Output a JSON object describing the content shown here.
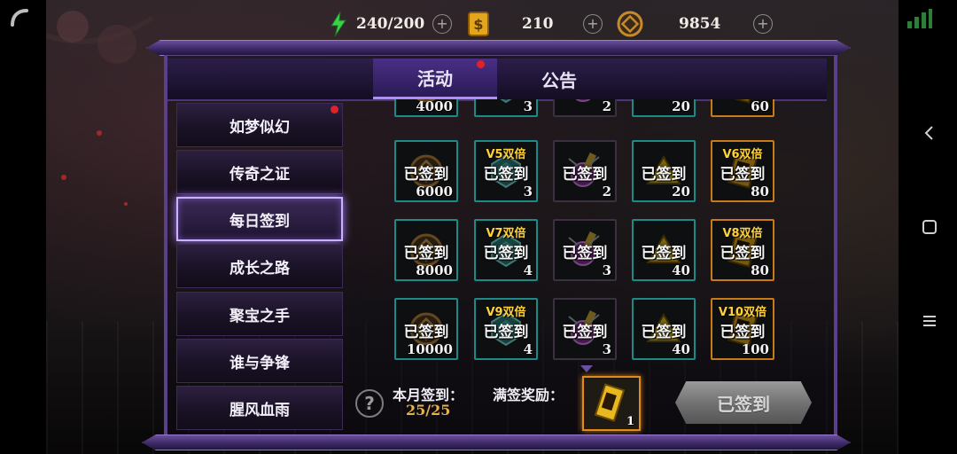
{
  "resources": {
    "energy": {
      "icon": "lightning-icon",
      "value": "240/200"
    },
    "ticket": {
      "icon": "gold-ticket-icon",
      "value": "210"
    },
    "coin": {
      "icon": "coin-icon",
      "value": "9854"
    }
  },
  "tabs": [
    {
      "label": "活动",
      "active": true,
      "badge": true
    },
    {
      "label": "公告",
      "active": false,
      "badge": false
    }
  ],
  "sidebar": {
    "items": [
      {
        "label": "如梦似幻",
        "badge": true
      },
      {
        "label": "传奇之证"
      },
      {
        "label": "每日签到",
        "active": true
      },
      {
        "label": "成长之路"
      },
      {
        "label": "聚宝之手"
      },
      {
        "label": "谁与争锋"
      },
      {
        "label": "腥风血雨"
      }
    ]
  },
  "grid": {
    "signed_label": "已签到",
    "partial_row": [
      {
        "item": "coin",
        "qty": "4000"
      },
      {
        "item": "gem",
        "qty": "3"
      },
      {
        "item": "potion",
        "qty": "2"
      },
      {
        "item": "gold-triangle",
        "qty": "20"
      },
      {
        "item": "scroll",
        "qty": "60"
      }
    ],
    "rows": [
      [
        {
          "item": "coin",
          "qty": "6000",
          "vip": ""
        },
        {
          "item": "gem",
          "qty": "3",
          "vip": "V5双倍"
        },
        {
          "item": "potion",
          "qty": "2",
          "vip": ""
        },
        {
          "item": "gold-triangle",
          "qty": "20",
          "vip": ""
        },
        {
          "item": "scroll",
          "qty": "80",
          "vip": "V6双倍"
        }
      ],
      [
        {
          "item": "coin",
          "qty": "8000",
          "vip": ""
        },
        {
          "item": "gem",
          "qty": "4",
          "vip": "V7双倍"
        },
        {
          "item": "potion",
          "qty": "3",
          "vip": ""
        },
        {
          "item": "gold-triangle",
          "qty": "40",
          "vip": ""
        },
        {
          "item": "scroll",
          "qty": "80",
          "vip": "V8双倍"
        }
      ],
      [
        {
          "item": "coin",
          "qty": "10000",
          "vip": ""
        },
        {
          "item": "gem",
          "qty": "4",
          "vip": "V9双倍"
        },
        {
          "item": "potion",
          "qty": "3",
          "vip": ""
        },
        {
          "item": "gold-triangle",
          "qty": "40",
          "vip": ""
        },
        {
          "item": "scroll",
          "qty": "100",
          "vip": "V10双倍"
        }
      ]
    ]
  },
  "footer": {
    "help_icon": "question-icon",
    "month_label": "本月签到：",
    "month_count": "25/25",
    "full_reward_label": "满签奖励：",
    "reward_qty": "1",
    "button_label": "已签到"
  },
  "system_nav": {
    "back": "back-chevron-icon",
    "home": "home-square-icon",
    "menu": "menu-lines-icon"
  }
}
